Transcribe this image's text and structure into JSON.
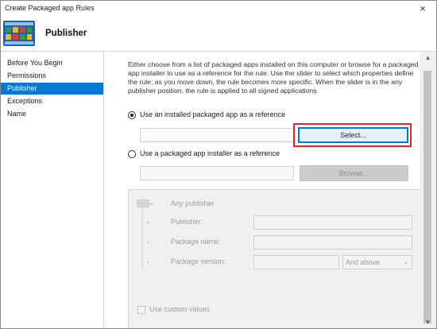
{
  "window": {
    "title": "Create Packaged app Rules",
    "close_icon": "×"
  },
  "header": {
    "title": "Publisher",
    "icon": "app-tiles-icon"
  },
  "sidebar": {
    "items": [
      {
        "label": "Before You Begin"
      },
      {
        "label": "Permissions"
      },
      {
        "label": "Publisher"
      },
      {
        "label": "Exceptions"
      },
      {
        "label": "Name"
      }
    ],
    "active": "Publisher"
  },
  "main": {
    "description": "Either choose from a list of packaged apps installed on this computer or browse for a packaged app installer to use as a reference for the rule. Use the slider to select which properties define the rule; as you move down, the rule becomes more specific. When the slider is in the any publisher position, the rule is applied to all signed applications.",
    "option_installed": {
      "label": "Use an installed packaged app as a reference",
      "selected": true,
      "value": "",
      "button_label": "Select..."
    },
    "option_installer": {
      "label": "Use a packaged app installer as a reference",
      "selected": false,
      "value": "",
      "button_label": "Browse..."
    },
    "properties": {
      "any_publisher": "Any publisher",
      "publisher_label": "Publisher:",
      "package_name_label": "Package name:",
      "package_version_label": "Package version:",
      "version_qualifier": "And above",
      "use_custom_values": "Use custom values",
      "slider_level": "Any publisher"
    }
  },
  "colors": {
    "accent": "#0078d7",
    "highlight": "#e0262a",
    "selected_nav_text": "#ffffff",
    "disabled_text": "#9c9c9c"
  }
}
